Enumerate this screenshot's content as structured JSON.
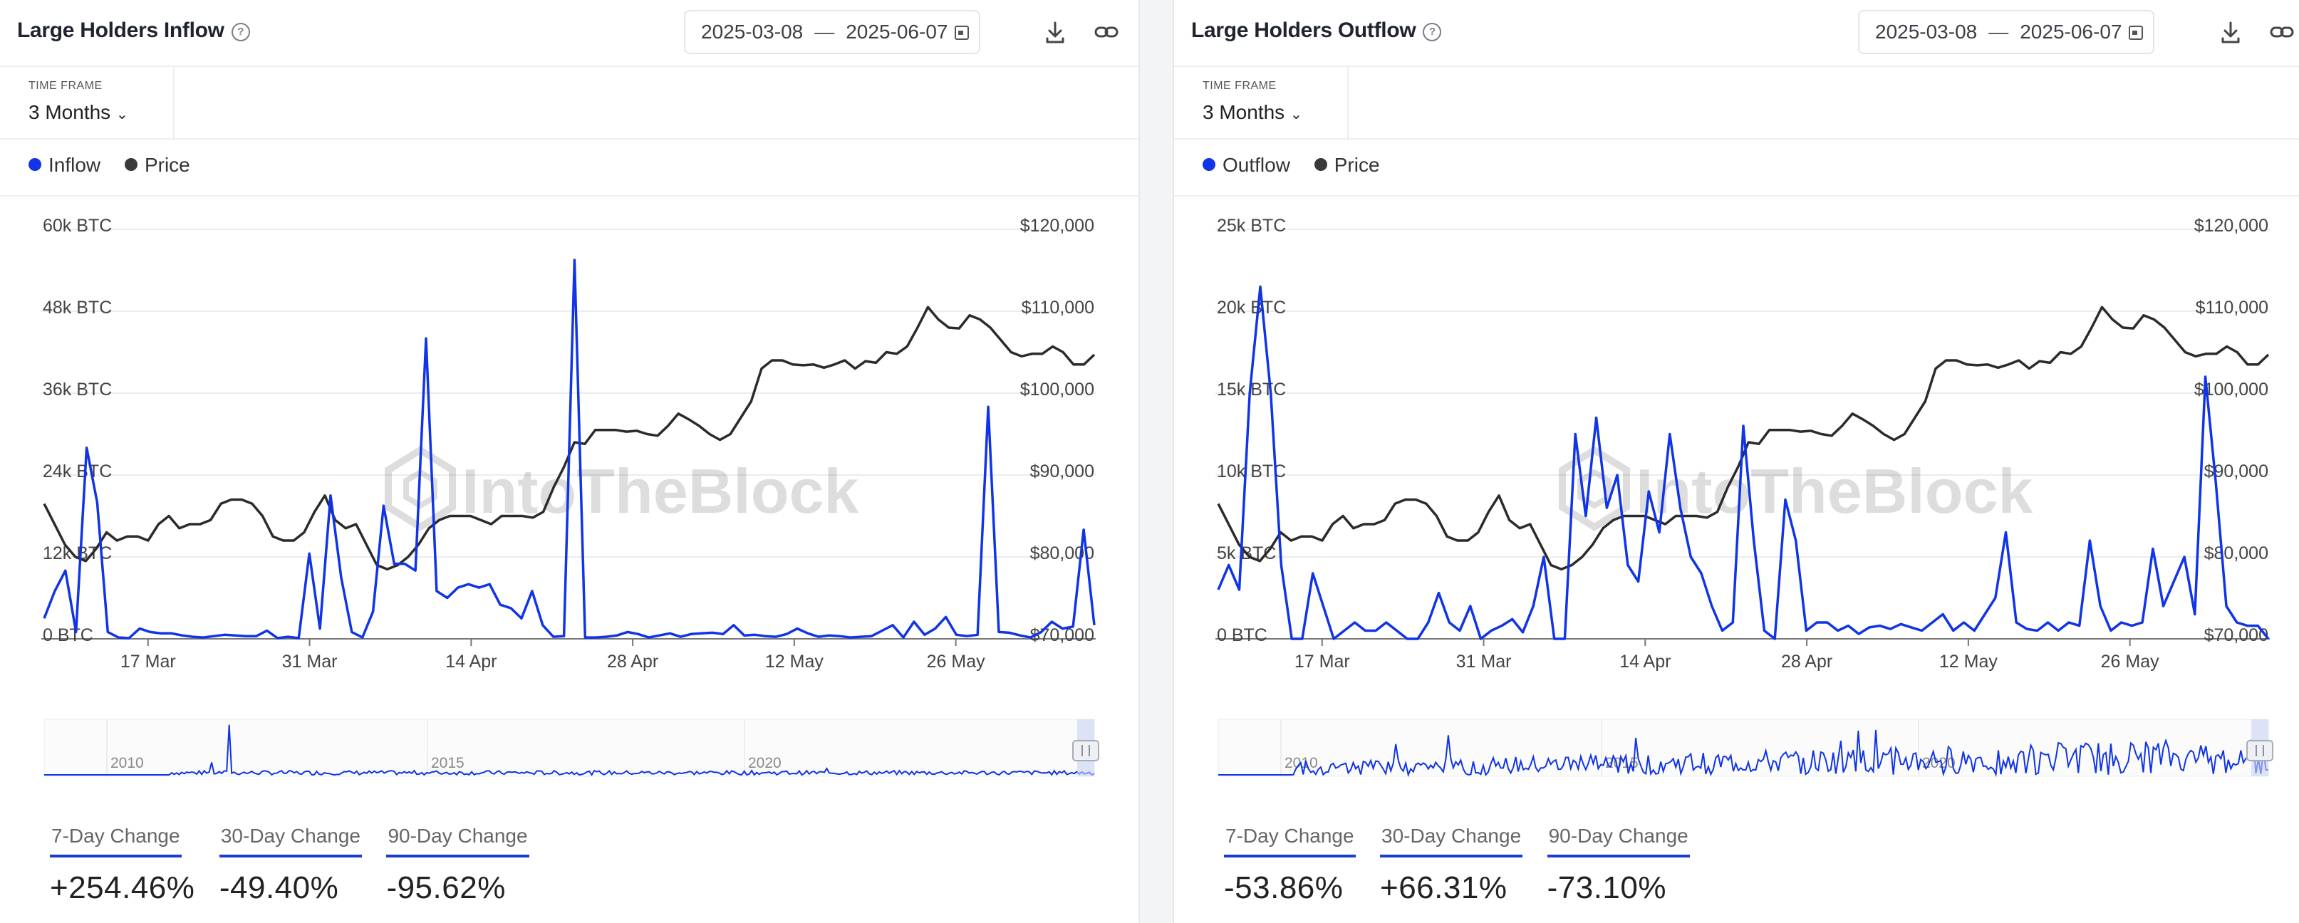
{
  "colors": {
    "flow": "#1034e6",
    "price": "#2b2b2b",
    "stat_underline": "#1a3bd4"
  },
  "panels": [
    {
      "title": "Large Holders Inflow",
      "date_from": "2025-03-08",
      "date_sep": "—",
      "date_to": "2025-06-07",
      "time_frame_label": "TIME FRAME",
      "time_frame_value": "3 Months",
      "legend_flow": "Inflow",
      "legend_price": "Price",
      "stats": [
        {
          "label": "7-Day Change",
          "value": "+254.46%"
        },
        {
          "label": "30-Day Change",
          "value": "-49.40%"
        },
        {
          "label": "90-Day Change",
          "value": "-95.62%"
        }
      ]
    },
    {
      "title": "Large Holders Outflow",
      "date_from": "2025-03-08",
      "date_sep": "—",
      "date_to": "2025-06-07",
      "time_frame_label": "TIME FRAME",
      "time_frame_value": "3 Months",
      "legend_flow": "Outflow",
      "legend_price": "Price",
      "stats": [
        {
          "label": "7-Day Change",
          "value": "-53.86%"
        },
        {
          "label": "30-Day Change",
          "value": "+66.31%"
        },
        {
          "label": "90-Day Change",
          "value": "-73.10%"
        }
      ]
    }
  ],
  "chart_data": [
    {
      "type": "line",
      "title": "Large Holders Inflow",
      "x_start": "2025-03-08",
      "x_end": "2025-06-07",
      "x_tick_labels": [
        "17 Mar",
        "31 Mar",
        "14 Apr",
        "28 Apr",
        "12 May",
        "26 May"
      ],
      "x_tick_dates": [
        "2025-03-17",
        "2025-03-31",
        "2025-04-14",
        "2025-04-28",
        "2025-05-12",
        "2025-05-26"
      ],
      "y_left_ticks": [
        "0 BTC",
        "12k BTC",
        "24k BTC",
        "36k BTC",
        "48k BTC",
        "60k BTC"
      ],
      "y_left_range": [
        0,
        60000
      ],
      "y_right_ticks": [
        "$70,000",
        "$80,000",
        "$90,000",
        "$100,000",
        "$110,000",
        "$120,000"
      ],
      "y_right_range": [
        70000,
        120000
      ],
      "navigator_labels": [
        "2010",
        "2015",
        "2020"
      ],
      "series": [
        {
          "name": "Inflow",
          "axis": "left",
          "values": [
            3000,
            7000,
            10000,
            1000,
            28000,
            20000,
            1000,
            200,
            100,
            1500,
            1000,
            800,
            800,
            500,
            300,
            200,
            400,
            600,
            500,
            400,
            400,
            1200,
            100,
            300,
            100,
            12500,
            1500,
            21000,
            9000,
            1000,
            200,
            4000,
            19500,
            11000,
            11000,
            10000,
            44000,
            7000,
            6000,
            7500,
            8000,
            7500,
            8000,
            5000,
            4500,
            3000,
            7000,
            2000,
            300,
            400,
            55500,
            200,
            200,
            300,
            500,
            1000,
            700,
            200,
            500,
            800,
            300,
            700,
            800,
            900,
            700,
            2000,
            500,
            600,
            400,
            300,
            700,
            1500,
            800,
            300,
            500,
            400,
            200,
            300,
            400,
            1200,
            2000,
            200,
            2500,
            600,
            1500,
            3200,
            600,
            400,
            600,
            34000,
            1000,
            900,
            500,
            200,
            1000,
            2500,
            1500,
            1800,
            16000,
            2000
          ]
        },
        {
          "name": "Price",
          "axis": "right",
          "values": [
            86500,
            84000,
            81500,
            80000,
            79500,
            81000,
            83000,
            82000,
            82500,
            82500,
            82000,
            84000,
            85000,
            83500,
            84000,
            84000,
            84500,
            86500,
            87000,
            87000,
            86500,
            85000,
            82500,
            82000,
            82000,
            83000,
            85500,
            87500,
            84500,
            83500,
            84000,
            81500,
            79000,
            78500,
            79000,
            80000,
            81500,
            83500,
            84500,
            85000,
            85000,
            85000,
            84500,
            84000,
            85000,
            85000,
            85000,
            84800,
            85500,
            88500,
            91000,
            94000,
            93800,
            95500,
            95500,
            95500,
            95300,
            95400,
            95000,
            94800,
            96000,
            97500,
            96800,
            96000,
            95000,
            94300,
            95000,
            97000,
            99000,
            103000,
            104000,
            104000,
            103500,
            103400,
            103500,
            103100,
            103500,
            104000,
            103000,
            103900,
            103700,
            105000,
            104800,
            105700,
            108000,
            110500,
            109000,
            108000,
            107900,
            109500,
            109000,
            108000,
            106500,
            105000,
            104500,
            104800,
            104800,
            105700,
            105000,
            103500,
            103500,
            104700
          ]
        }
      ]
    },
    {
      "type": "line",
      "title": "Large Holders Outflow",
      "x_start": "2025-03-08",
      "x_end": "2025-06-07",
      "x_tick_labels": [
        "17 Mar",
        "31 Mar",
        "14 Apr",
        "28 Apr",
        "12 May",
        "26 May"
      ],
      "x_tick_dates": [
        "2025-03-17",
        "2025-03-31",
        "2025-04-14",
        "2025-04-28",
        "2025-05-12",
        "2025-05-26"
      ],
      "y_left_ticks": [
        "0 BTC",
        "5k BTC",
        "10k BTC",
        "15k BTC",
        "20k BTC",
        "25k BTC"
      ],
      "y_left_range": [
        0,
        25000
      ],
      "y_right_ticks": [
        "$70,000",
        "$80,000",
        "$90,000",
        "$100,000",
        "$110,000",
        "$120,000"
      ],
      "y_right_range": [
        70000,
        120000
      ],
      "navigator_labels": [
        "2010",
        "2015",
        "2020"
      ],
      "series": [
        {
          "name": "Outflow",
          "axis": "left",
          "values": [
            3000,
            4500,
            3000,
            15000,
            21500,
            15000,
            4500,
            0,
            0,
            4000,
            2000,
            0,
            500,
            1000,
            500,
            500,
            1000,
            500,
            0,
            0,
            1000,
            2800,
            1000,
            500,
            2000,
            0,
            500,
            800,
            1200,
            400,
            2000,
            5000,
            0,
            0,
            12500,
            7500,
            13500,
            8000,
            10000,
            4500,
            3500,
            9000,
            6500,
            12500,
            8000,
            5000,
            4000,
            2000,
            500,
            1000,
            13000,
            6000,
            500,
            0,
            8500,
            6000,
            500,
            1000,
            1000,
            500,
            800,
            300,
            700,
            800,
            600,
            900,
            700,
            500,
            1000,
            1500,
            500,
            1000,
            500,
            1500,
            2500,
            6500,
            1000,
            600,
            500,
            1000,
            500,
            1000,
            800,
            6000,
            2000,
            500,
            1000,
            800,
            1000,
            5500,
            2000,
            3500,
            5000,
            1500,
            16000,
            9500,
            2000,
            1000,
            800,
            800,
            0
          ]
        },
        {
          "name": "Price",
          "axis": "right",
          "values": [
            86500,
            84000,
            81500,
            80000,
            79500,
            81000,
            83000,
            82000,
            82500,
            82500,
            82000,
            84000,
            85000,
            83500,
            84000,
            84000,
            84500,
            86500,
            87000,
            87000,
            86500,
            85000,
            82500,
            82000,
            82000,
            83000,
            85500,
            87500,
            84500,
            83500,
            84000,
            81500,
            79000,
            78500,
            79000,
            80000,
            81500,
            83500,
            84500,
            85000,
            85000,
            85000,
            84500,
            84000,
            85000,
            85000,
            85000,
            84800,
            85500,
            88500,
            91000,
            94000,
            93800,
            95500,
            95500,
            95500,
            95300,
            95400,
            95000,
            94800,
            96000,
            97500,
            96800,
            96000,
            95000,
            94300,
            95000,
            97000,
            99000,
            103000,
            104000,
            104000,
            103500,
            103400,
            103500,
            103100,
            103500,
            104000,
            103000,
            103900,
            103700,
            105000,
            104800,
            105700,
            108000,
            110500,
            109000,
            108000,
            107900,
            109500,
            109000,
            108000,
            106500,
            105000,
            104500,
            104800,
            104800,
            105700,
            105000,
            103500,
            103500,
            104700
          ]
        }
      ]
    }
  ]
}
